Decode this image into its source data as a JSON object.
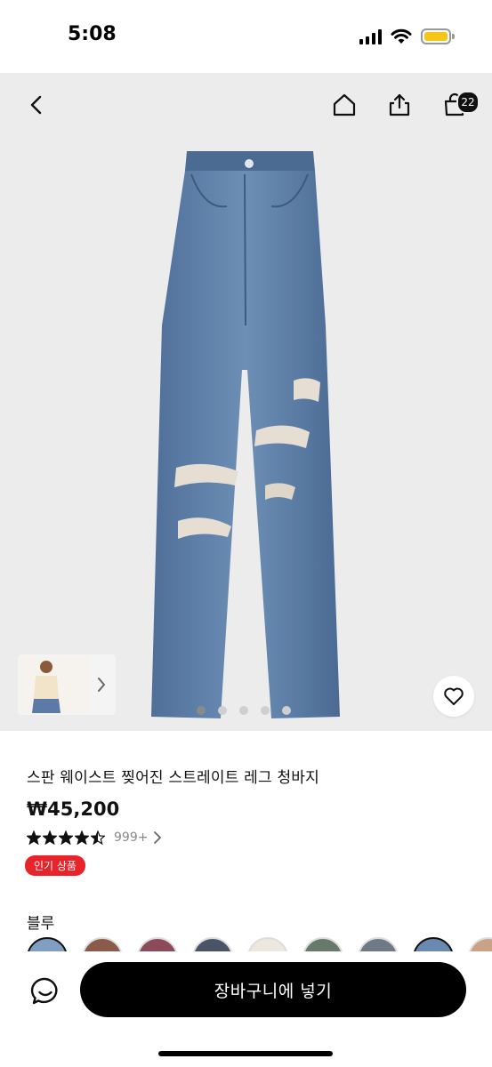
{
  "status_bar": {
    "time": "5:08",
    "battery_color": "#f5c518",
    "icons": [
      "cellular-signal-icon",
      "wifi-icon",
      "battery-icon"
    ]
  },
  "header": {
    "back_icon": "chevron-left-icon",
    "home_icon": "home-icon",
    "share_icon": "share-icon",
    "cart_icon": "shopping-bag-icon",
    "cart_count": "22"
  },
  "gallery": {
    "page_count": 5,
    "active_page": 1,
    "thumbnail_arrow": "chevron-right-icon",
    "favorite_icon": "heart-icon"
  },
  "product": {
    "title": "스판 웨이스트 찢어진 스트레이트 레그 청바지",
    "price": "₩45,200",
    "rating_stars": 4.5,
    "rating_count": "999+",
    "badge": "인기 상품",
    "badge_color": "#e8242a",
    "color_label": "블루",
    "swatch_colors": [
      "#7f9ec2",
      "#8a5a4a",
      "#8c4a5a",
      "#4a5468",
      "#ece8de",
      "#667a6a",
      "#6f7a86",
      "#6a88b0",
      "#c9a288"
    ]
  },
  "bottom_bar": {
    "chat_icon": "chat-bubble-icon",
    "add_to_cart_label": "장바구니에 넣기"
  }
}
